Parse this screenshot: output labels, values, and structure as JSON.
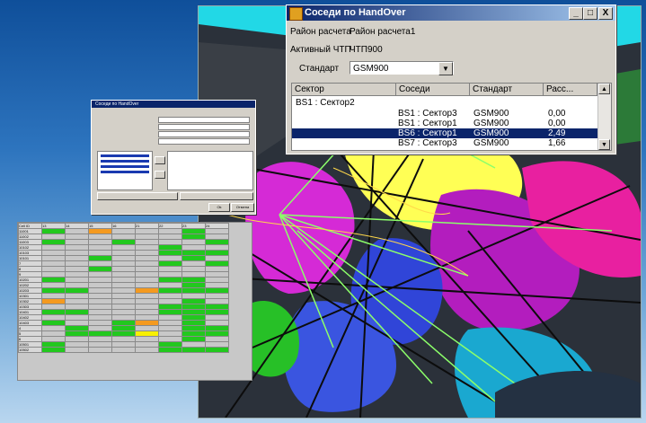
{
  "window": {
    "title": "Соседи по HandOver",
    "controls": [
      "_",
      "□",
      "X"
    ]
  },
  "fields": {
    "area_label": "Район расчета",
    "area_value": "Район расчета1",
    "active_label": "Активный ЧТП",
    "active_value": "ЧТП900",
    "standard_label": "Стандарт",
    "standard_value": "GSM900"
  },
  "list": {
    "columns": [
      "Сектор",
      "Соседи",
      "Стандарт",
      "Расс..."
    ],
    "group": "BS1 : Сектор2",
    "rows": [
      {
        "neighbor": "BS1 : Сектор3",
        "standard": "GSM900",
        "dist": "0,00",
        "selected": false
      },
      {
        "neighbor": "BS1 : Сектор1",
        "standard": "GSM900",
        "dist": "0,00",
        "selected": false
      },
      {
        "neighbor": "BS6 : Сектор1",
        "standard": "GSM900",
        "dist": "2,49",
        "selected": true
      },
      {
        "neighbor": "BS7 : Сектор3",
        "standard": "GSM900",
        "dist": "1,66",
        "selected": false
      }
    ]
  },
  "small_dialog": {
    "title": "Соседи по HandOver",
    "ok": "Ok",
    "cancel": "Отмена"
  },
  "grid": {
    "corner": "Cell ID",
    "columns": [
      "13",
      "14",
      "15",
      "16",
      "21",
      "22",
      "23",
      "24"
    ],
    "rows": [
      "11001",
      "11002",
      "11003",
      "10102",
      "10103",
      "10101",
      "7",
      "8",
      "9",
      "10201",
      "10202",
      "10203",
      "10301",
      "10302",
      "10303",
      "10401",
      "10402",
      "10403",
      "4",
      "5",
      "6",
      "10501",
      "10502"
    ]
  },
  "colors": {
    "title_bar": "#0a246a",
    "selected_row": "#0a246a",
    "grid_green": "#22c81e",
    "grid_orange": "#f49a20",
    "grid_yellow": "#f8f000"
  }
}
